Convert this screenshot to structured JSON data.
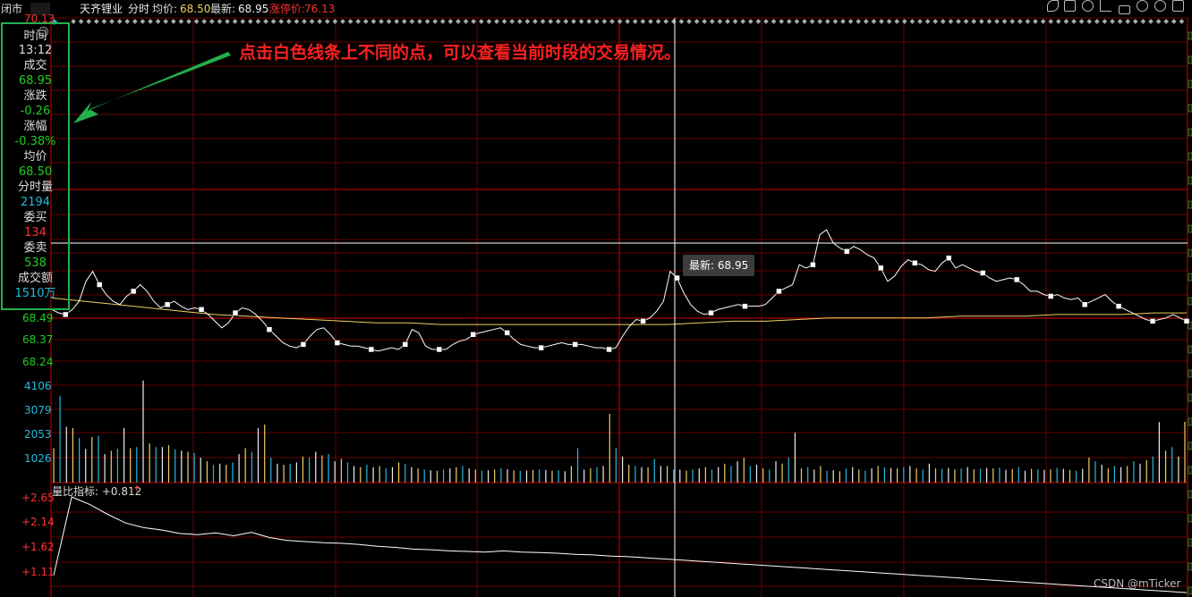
{
  "header": {
    "status": "闭市",
    "stock_name": "天齐锂业",
    "view_mode": "分时",
    "avg_label": "均价:",
    "avg_value": "68.50",
    "latest_label": "最新:",
    "latest_value": "68.95",
    "limit_up_label": "涨停价:",
    "limit_up_value": "76.13",
    "icons": [
      "eye-icon",
      "hand-icon",
      "play-icon",
      "undo-icon",
      "lock-icon",
      "zoom-in-icon",
      "zoom-out-icon"
    ]
  },
  "price_axis": {
    "top_label": "70.13",
    "labels": [
      "68.49",
      "68.37",
      "68.24"
    ]
  },
  "volume_axis": {
    "labels": [
      "4106",
      "3079",
      "2053",
      "1026"
    ]
  },
  "indicator": {
    "title": "量比指标: +0.812",
    "arrow": "↑",
    "labels": [
      "+2.65",
      "+2.14",
      "+1.62",
      "+1.11"
    ]
  },
  "info_panel": {
    "time_label": "时间",
    "time_value": "13:12",
    "price_label": "成交",
    "price_value": "68.95",
    "change_label": "涨跌",
    "change_value": "-0.26",
    "pct_label": "涨幅",
    "pct_value": "-0.38%",
    "avg_label": "均价",
    "avg_value": "68.50",
    "vol_label": "分时量",
    "vol_value": "2194",
    "bid_label": "委买",
    "bid_value": "134",
    "ask_label": "委卖",
    "ask_value": "538",
    "amount_label": "成交额",
    "amount_value": "1510万"
  },
  "annotation": "点击白色线条上不同的点，可以查看当前时段的交易情况。",
  "tooltip": "最新: 68.95",
  "watermark": "CSDN @mTicker",
  "colors": {
    "grid_red": "#8c0000",
    "price_line": "#ffffff",
    "avg_line": "#f0d060",
    "up": "#ff3030",
    "down": "#22cc22",
    "cyan": "#22bbdd",
    "annotation_red": "#ff2020",
    "box_green": "#22b14c"
  },
  "chart_data": {
    "type": "line",
    "title": "",
    "series": [
      {
        "values": [
          68.55,
          68.53,
          68.52,
          68.55,
          68.6,
          68.72,
          68.78,
          68.7,
          68.64,
          68.6,
          68.58,
          68.63,
          68.66,
          68.7,
          68.66,
          68.6,
          68.56,
          68.58,
          68.6,
          68.57,
          68.55,
          68.56,
          68.55,
          68.52,
          68.48,
          68.44,
          68.47,
          68.53,
          68.56,
          68.55,
          68.52,
          68.48,
          68.43,
          68.39,
          68.35,
          68.33,
          68.32,
          68.34,
          68.39,
          68.43,
          68.44,
          68.4,
          68.35,
          68.34,
          68.33,
          68.33,
          68.32,
          68.31,
          68.3,
          68.31,
          68.32,
          68.31,
          68.34,
          68.43,
          68.41,
          68.33,
          68.31,
          68.31,
          68.31,
          68.34,
          68.36,
          68.37,
          68.4,
          68.41,
          68.42,
          68.43,
          68.44,
          68.41,
          68.37,
          68.34,
          68.33,
          68.32,
          68.32,
          68.33,
          68.34,
          68.35,
          68.34,
          68.34,
          68.34,
          68.33,
          68.32,
          68.32,
          68.31,
          68.32,
          68.39,
          68.45,
          68.49,
          68.48,
          68.5,
          68.54,
          68.6,
          68.78,
          68.74,
          68.65,
          68.58,
          68.54,
          68.52,
          68.53,
          68.55,
          68.56,
          68.57,
          68.58,
          68.57,
          68.57,
          68.57,
          68.58,
          68.62,
          68.66,
          68.68,
          68.7,
          68.82,
          68.8,
          68.82,
          69.0,
          69.03,
          68.95,
          68.92,
          68.9,
          68.93,
          68.91,
          68.88,
          68.86,
          68.8,
          68.72,
          68.75,
          68.81,
          68.85,
          68.83,
          68.82,
          68.79,
          68.78,
          68.83,
          68.86,
          68.8,
          68.82,
          68.8,
          68.78,
          68.77,
          68.74,
          68.72,
          68.73,
          68.74,
          68.73,
          68.7,
          68.66,
          68.66,
          68.64,
          68.63,
          68.64,
          68.62,
          68.61,
          68.62,
          68.58,
          68.6,
          68.62,
          68.64,
          68.6,
          68.57,
          68.55,
          68.53,
          68.51,
          68.49,
          68.48,
          68.49,
          68.5,
          68.52,
          68.5,
          68.48
        ]
      },
      {
        "values": [
          68.62,
          68.6,
          68.58,
          68.56,
          68.54,
          68.52,
          68.51,
          68.5,
          68.49,
          68.48,
          68.47,
          68.47,
          68.46,
          68.46,
          68.46,
          68.46,
          68.46,
          68.46,
          68.46,
          68.46,
          68.47,
          68.48,
          68.48,
          68.49,
          68.5,
          68.5,
          68.5,
          68.5,
          68.51,
          68.51,
          68.51,
          68.52,
          68.52,
          68.52,
          68.53,
          68.53
        ]
      }
    ],
    "volume": [
      1450,
      3650,
      2350,
      2300,
      1880,
      1420,
      1920,
      1970,
      1200,
      1340,
      1430,
      2300,
      1450,
      1500,
      4300,
      1650,
      1500,
      1500,
      1580,
      1400,
      1350,
      1300,
      1250,
      1050,
      900,
      750,
      800,
      750,
      850,
      1200,
      1450,
      1300,
      2300,
      2450,
      1050,
      800,
      750,
      800,
      850,
      1100,
      1050,
      1300,
      1150,
      1200,
      900,
      1000,
      850,
      700,
      650,
      750,
      650,
      700,
      600,
      650,
      850,
      800,
      650,
      600,
      550,
      520,
      500,
      550,
      600,
      650,
      700,
      600,
      550,
      500,
      520,
      550,
      600,
      560,
      520,
      500,
      510,
      540,
      560,
      530,
      500,
      520,
      480,
      700,
      1450,
      550,
      600,
      650,
      700,
      2900,
      1450,
      1100,
      750,
      700,
      650,
      650,
      1000,
      700,
      700,
      550,
      550,
      500,
      550,
      600,
      650,
      550,
      650,
      800,
      700,
      900,
      1050,
      700,
      750,
      600,
      550,
      900,
      800,
      1050,
      2100,
      600,
      650,
      550,
      700,
      500,
      520,
      480,
      600,
      650,
      550,
      500,
      600,
      700,
      650,
      620,
      600,
      650,
      700,
      600,
      550,
      800,
      600,
      580,
      620,
      550,
      600,
      650,
      560,
      580,
      620,
      600,
      630,
      540,
      570,
      660,
      500,
      580,
      560,
      540,
      560,
      620,
      580,
      540,
      500,
      580,
      1050,
      900,
      750,
      600,
      700,
      650,
      700,
      900,
      800,
      950,
      1100,
      2550,
      1350,
      1500,
      1100,
      2560
    ],
    "indicator": [
      1.3,
      2.65,
      2.52,
      2.35,
      2.2,
      2.12,
      2.08,
      2.02,
      2.0,
      2.03,
      1.98,
      2.04,
      1.95,
      1.9,
      1.88,
      1.86,
      1.85,
      1.83,
      1.8,
      1.78,
      1.75,
      1.74,
      1.72,
      1.71,
      1.7,
      1.72,
      1.7,
      1.69,
      1.68,
      1.66,
      1.65,
      1.63,
      1.62,
      1.6,
      1.58,
      1.56,
      1.54,
      1.52,
      1.5,
      1.48,
      1.46,
      1.44,
      1.42,
      1.4,
      1.38,
      1.36,
      1.34,
      1.32,
      1.3,
      1.28,
      1.26,
      1.24,
      1.22,
      1.2,
      1.18,
      1.16,
      1.14,
      1.12,
      1.1,
      1.08,
      1.06,
      1.04,
      1.02,
      1.0
    ]
  }
}
